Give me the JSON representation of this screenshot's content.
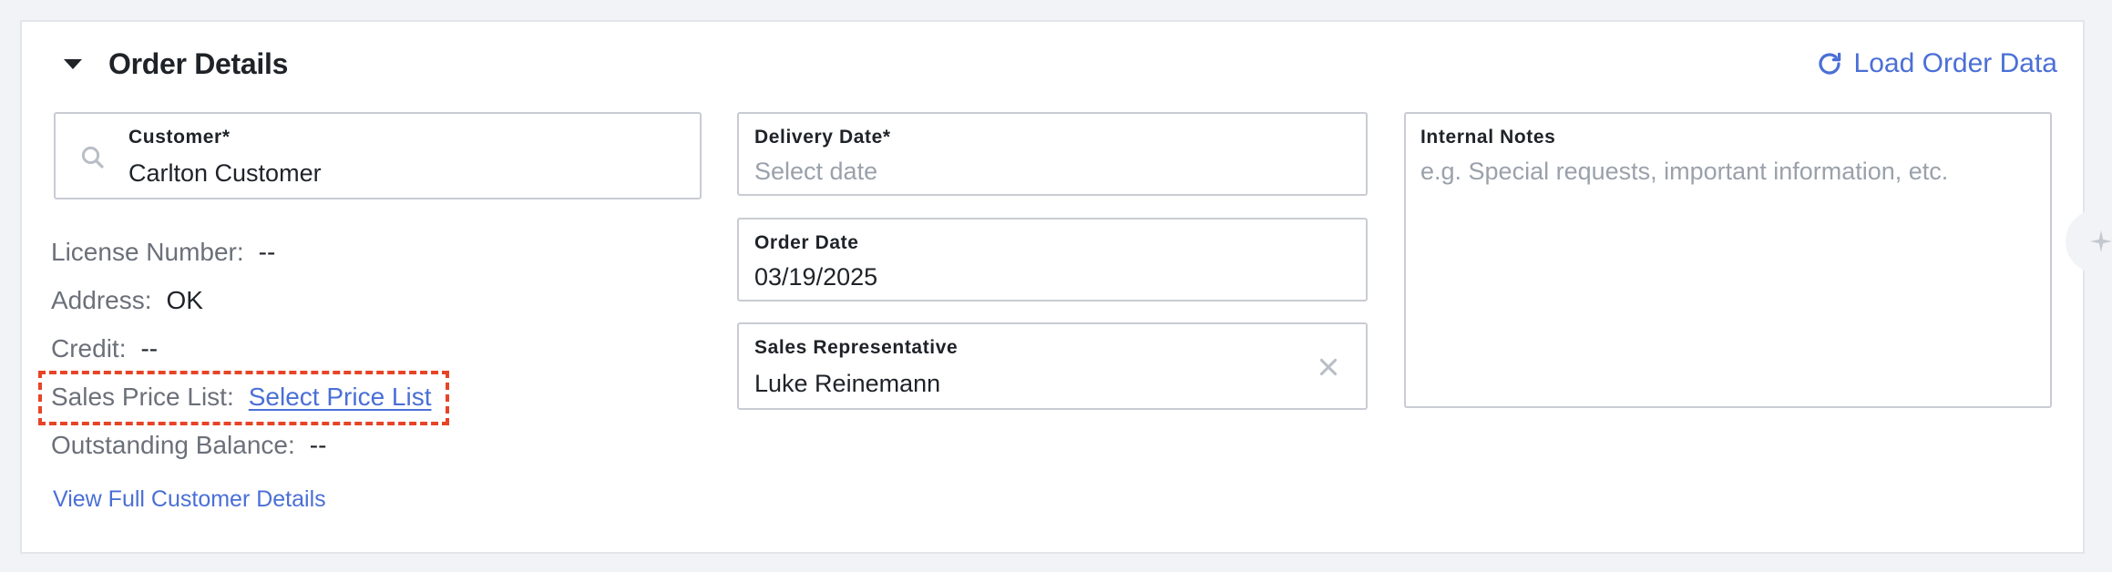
{
  "section": {
    "title": "Order Details",
    "load_action": "Load Order Data"
  },
  "customer": {
    "label": "Customer*",
    "value": "Carlton Customer"
  },
  "customer_info": {
    "license": {
      "label": "License Number:",
      "value": "--"
    },
    "address": {
      "label": "Address:",
      "value": "OK"
    },
    "credit": {
      "label": "Credit:",
      "value": "--"
    },
    "price_list": {
      "label": "Sales Price List:",
      "link": "Select Price List"
    },
    "balance": {
      "label": "Outstanding Balance:",
      "value": "--"
    },
    "view_details": "View Full Customer Details"
  },
  "delivery_date": {
    "label": "Delivery Date*",
    "placeholder": "Select date"
  },
  "order_date": {
    "label": "Order Date",
    "value": "03/19/2025"
  },
  "sales_rep": {
    "label": "Sales Representative",
    "value": "Luke Reinemann"
  },
  "internal_notes": {
    "label": "Internal Notes",
    "placeholder": "e.g. Special requests, important information, etc."
  },
  "colors": {
    "accent": "#4a6fd6",
    "highlight": "#e74427",
    "border": "#c9ccd3",
    "muted_text": "#6b7079"
  },
  "icons": {
    "collapse": "caret-down-icon",
    "reload": "refresh-icon",
    "search": "search-icon",
    "clear": "close-icon",
    "side": "sparkle-icon"
  }
}
